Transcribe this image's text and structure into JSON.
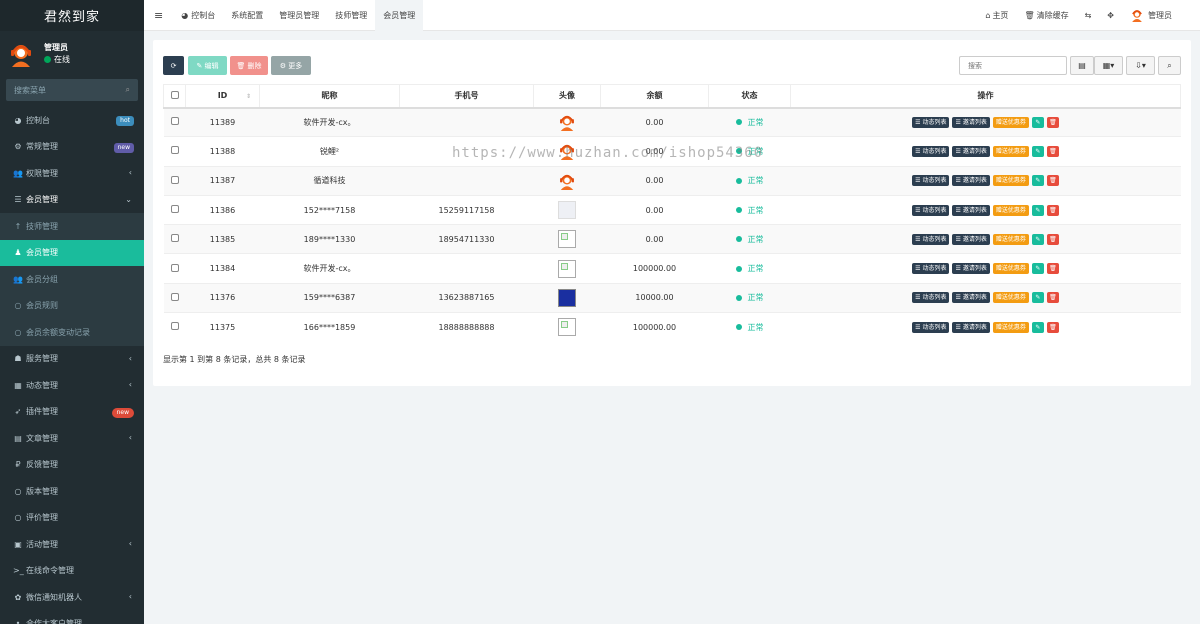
{
  "app": {
    "title": "君然到家"
  },
  "user": {
    "name": "管理员",
    "status": "在线"
  },
  "sidebar": {
    "search_placeholder": "搜索菜单",
    "items": [
      {
        "icon": "dashboard-icon",
        "glyph": "◕",
        "label": "控制台",
        "badge": "hot",
        "badge_type": "hot"
      },
      {
        "icon": "cogs-icon",
        "glyph": "⚙",
        "label": "常规管理",
        "badge": "new",
        "badge_type": "new"
      },
      {
        "icon": "users-icon",
        "glyph": "👥",
        "label": "权限管理",
        "arrow": "‹"
      },
      {
        "icon": "list-icon",
        "glyph": "☰",
        "label": "会员管理",
        "arrow": "⌄",
        "open": true
      },
      {
        "icon": "tech-icon",
        "glyph": "↑",
        "label": "技师管理",
        "sub": true
      },
      {
        "icon": "user-icon",
        "glyph": "♟",
        "label": "会员管理",
        "sub": true,
        "active": true
      },
      {
        "icon": "users-group-icon",
        "glyph": "👥",
        "label": "会员分组",
        "sub": true
      },
      {
        "icon": "circle-icon",
        "glyph": "○",
        "label": "会员规则",
        "sub": true
      },
      {
        "icon": "circle-icon",
        "glyph": "○",
        "label": "会员余额变动记录",
        "sub": true
      },
      {
        "icon": "service-icon",
        "glyph": "☗",
        "label": "服务管理",
        "arrow": "‹"
      },
      {
        "icon": "calendar-icon",
        "glyph": "▦",
        "label": "动态管理",
        "arrow": "‹"
      },
      {
        "icon": "rocket-icon",
        "glyph": "➶",
        "label": "插件管理",
        "badge": "new",
        "badge_type": "newred"
      },
      {
        "icon": "file-icon",
        "glyph": "▤",
        "label": "文章管理",
        "arrow": "‹"
      },
      {
        "icon": "ruble-icon",
        "glyph": "₽",
        "label": "反馈管理"
      },
      {
        "icon": "circle-icon",
        "glyph": "○",
        "label": "版本管理"
      },
      {
        "icon": "circle-icon",
        "glyph": "○",
        "label": "评价管理"
      },
      {
        "icon": "calendar-check-icon",
        "glyph": "▣",
        "label": "活动管理",
        "arrow": "‹"
      },
      {
        "icon": "terminal-icon",
        "glyph": ">_",
        "label": "在线命令管理"
      },
      {
        "icon": "robot-icon",
        "glyph": "✿",
        "label": "微信通知机器人",
        "arrow": "‹"
      },
      {
        "icon": "more-icon",
        "glyph": "•",
        "label": "合作大客户管理"
      }
    ]
  },
  "topbar": {
    "menu_glyph": "≡",
    "tabs": [
      {
        "label": "控制台",
        "icon": "dashboard-icon",
        "glyph": "◕"
      },
      {
        "label": "系统配置"
      },
      {
        "label": "管理员管理"
      },
      {
        "label": "技师管理"
      },
      {
        "label": "会员管理",
        "active": true
      }
    ],
    "right": {
      "home": "主页",
      "clear_cache": "清除缓存",
      "admin": "管理员"
    }
  },
  "toolbar": {
    "refresh_glyph": "⟳",
    "edit": "✎ 编辑",
    "delete": "🗑 删除",
    "more": "⚙ 更多",
    "search_placeholder": "搜索"
  },
  "table": {
    "columns": [
      "ID",
      "昵称",
      "手机号",
      "头像",
      "余额",
      "状态",
      "操作"
    ],
    "rows": [
      {
        "id": "11389",
        "nickname": "软件开发-cx。",
        "phone": "",
        "avatar": "default",
        "balance": "0.00",
        "status": "正常"
      },
      {
        "id": "11388",
        "nickname": "锐鲤²",
        "phone": "",
        "avatar": "default",
        "balance": "0.00",
        "status": "正常"
      },
      {
        "id": "11387",
        "nickname": "循道科技",
        "phone": "",
        "avatar": "default",
        "balance": "0.00",
        "status": "正常"
      },
      {
        "id": "11386",
        "nickname": "152****7158",
        "phone": "15259117158",
        "avatar": "light",
        "balance": "0.00",
        "status": "正常"
      },
      {
        "id": "11385",
        "nickname": "189****1330",
        "phone": "18954711330",
        "avatar": "broken",
        "balance": "0.00",
        "status": "正常"
      },
      {
        "id": "11384",
        "nickname": "软件开发-cx。",
        "phone": "",
        "avatar": "broken",
        "balance": "100000.00",
        "status": "正常"
      },
      {
        "id": "11376",
        "nickname": "159****6387",
        "phone": "13623887165",
        "avatar": "blue",
        "balance": "10000.00",
        "status": "正常"
      },
      {
        "id": "11375",
        "nickname": "166****1859",
        "phone": "18888888888",
        "avatar": "broken",
        "balance": "100000.00",
        "status": "正常"
      }
    ],
    "row_actions": {
      "dynamic": "动态列表",
      "invite": "邀请列表",
      "coupon": "赠送优惠券"
    }
  },
  "pagination": {
    "summary": "显示第 1 到第 8 条记录，总共 8 条记录"
  },
  "watermark": "https://www.huzhan.com/ishop54360",
  "colors": {
    "sidebar_bg": "#222d32",
    "active": "#1abc9c",
    "dark_btn": "#2c3e50",
    "orange": "#f39c12",
    "red": "#e74c3c"
  }
}
